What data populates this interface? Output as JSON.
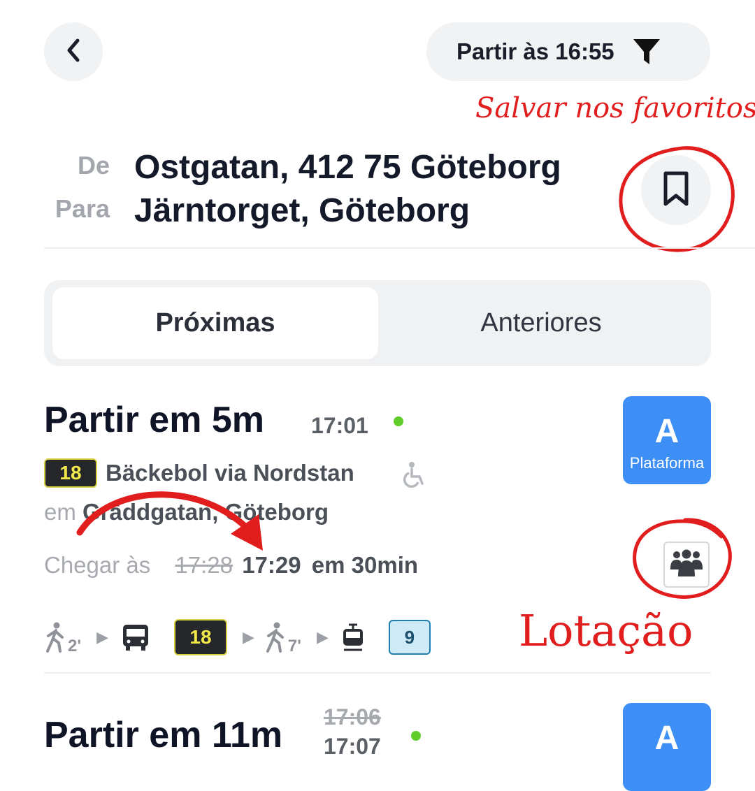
{
  "header": {
    "back_icon": "chevron-left-icon",
    "depart_label": "Partir às 16:55",
    "filter_icon": "filter-icon"
  },
  "route": {
    "from_label": "De",
    "from_value": "Ostgatan, 412 75 Göteborg",
    "to_label": "Para",
    "to_value": "Järntorget, Göteborg",
    "bookmark_icon": "bookmark-icon"
  },
  "annotations": {
    "favorites": "Salvar nos favoritos",
    "crowding": "Lotação"
  },
  "tabs": [
    {
      "label": "Próximas",
      "active": true
    },
    {
      "label": "Anteriores",
      "active": false
    }
  ],
  "trips": [
    {
      "title": "Partir em 5m",
      "depart_time": "17:01",
      "line": "18",
      "direction": "Bäckebol via Nordstan",
      "stop_prefix": "em",
      "stop": "Gräddgatan, Göteborg",
      "arrive_label": "Chegar às",
      "arrive_old": "17:28",
      "arrive_new": "17:29",
      "duration": "em 30min",
      "platform_letter": "A",
      "platform_word": "Plataforma",
      "legs": {
        "walk1": "2'",
        "bus_line": "18",
        "walk2": "7'",
        "tram_line": "9"
      }
    },
    {
      "title": "Partir em 11m",
      "depart_time_old": "17:06",
      "depart_time_new": "17:07",
      "platform_letter": "A"
    }
  ],
  "colors": {
    "accent_platform": "#3d8ff6",
    "live_dot": "#5fcc2a",
    "annotation_red": "#e11d1d",
    "line_badge_bg": "#25272b",
    "line_badge_text": "#f1e84a"
  }
}
